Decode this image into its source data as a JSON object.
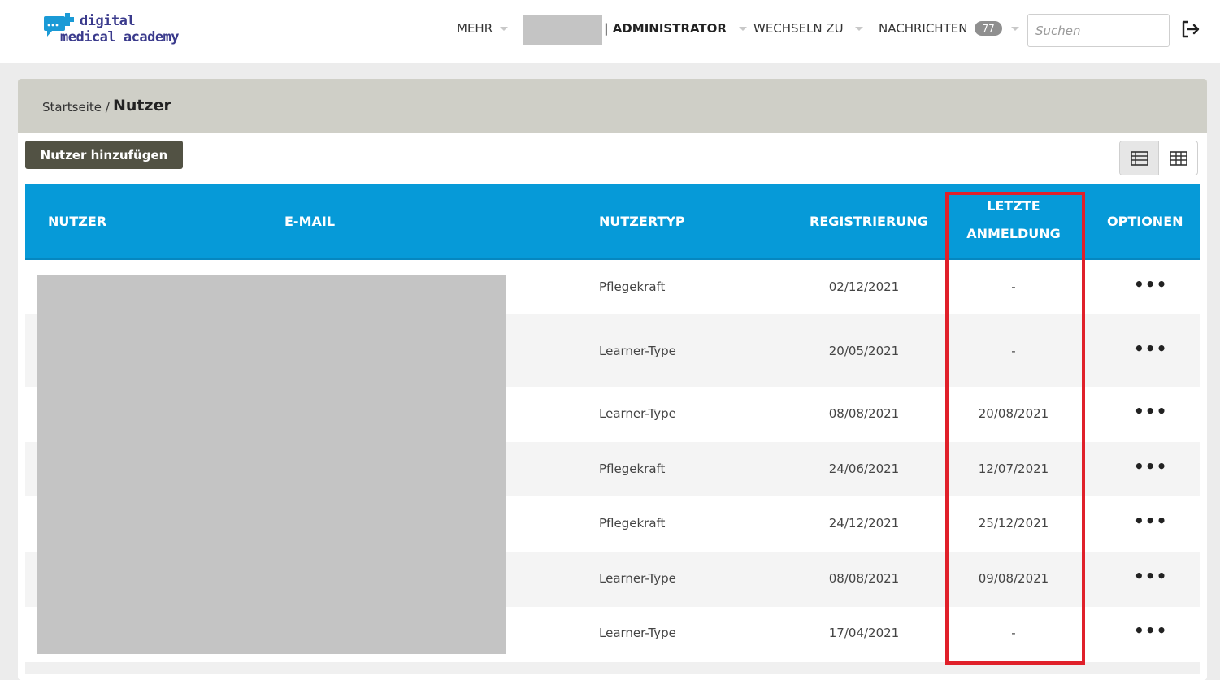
{
  "app": {
    "logo_line1": "digital",
    "logo_line2": "medical academy"
  },
  "header": {
    "more_label": "MEHR",
    "role_label": "| ADMINISTRATOR",
    "switch_label": "WECHSELN ZU",
    "messages_label": "NACHRICHTEN",
    "messages_count": "77",
    "search_placeholder": "Suchen"
  },
  "breadcrumb": {
    "home": "Startseite /",
    "current": "Nutzer"
  },
  "toolbar": {
    "add_user_label": "Nutzer hinzufügen"
  },
  "table": {
    "columns": {
      "user": "NUTZER",
      "email": "E-MAIL",
      "type": "NUTZERTYP",
      "registration": "REGISTRIERUNG",
      "last_login_1": "LETZTE",
      "last_login_2": "ANMELDUNG",
      "options": "OPTIONEN"
    },
    "options_glyph": "•••",
    "rows": [
      {
        "type": "Pflegekraft",
        "registration": "02/12/2021",
        "last_login": "-"
      },
      {
        "type": "Learner-Type",
        "registration": "20/05/2021",
        "last_login": "-"
      },
      {
        "type": "Learner-Type",
        "registration": "08/08/2021",
        "last_login": "20/08/2021"
      },
      {
        "type": "Pflegekraft",
        "registration": "24/06/2021",
        "last_login": "12/07/2021"
      },
      {
        "type": "Pflegekraft",
        "registration": "24/12/2021",
        "last_login": "25/12/2021"
      },
      {
        "type": "Learner-Type",
        "registration": "08/08/2021",
        "last_login": "09/08/2021"
      },
      {
        "type": "Learner-Type",
        "registration": "17/04/2021",
        "last_login": "-"
      }
    ]
  },
  "colors": {
    "table_header": "#069ad8",
    "breadcrumb_bg": "#cfcfc7",
    "add_button": "#525244",
    "highlight": "#e0202a",
    "badge": "#8f8f8f"
  }
}
